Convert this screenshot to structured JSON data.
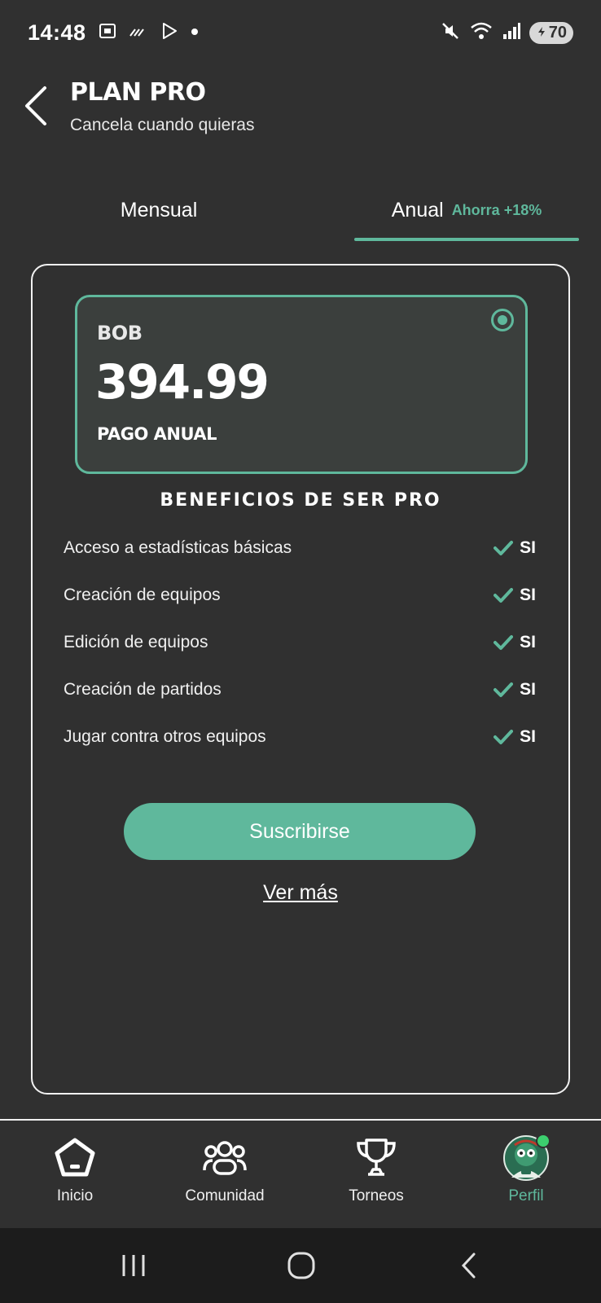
{
  "status_bar": {
    "time": "14:48",
    "battery": "70"
  },
  "header": {
    "title": "PLAN PRO",
    "subtitle": "Cancela cuando quieras"
  },
  "tabs": {
    "monthly": "Mensual",
    "annual": "Anual",
    "annual_badge": "Ahorra +18%",
    "selected": "annual"
  },
  "plan": {
    "currency": "BOB",
    "price": "394.99",
    "billing": "PAGO ANUAL"
  },
  "benefits": {
    "title": "BENEFICIOS DE SER PRO",
    "items": [
      {
        "label": "Acceso a estadísticas básicas",
        "value": "SI"
      },
      {
        "label": "Creación de equipos",
        "value": "SI"
      },
      {
        "label": "Edición de equipos",
        "value": "SI"
      },
      {
        "label": "Creación de partidos",
        "value": "SI"
      },
      {
        "label": "Jugar contra otros equipos",
        "value": "SI"
      }
    ]
  },
  "actions": {
    "subscribe": "Suscribirse",
    "see_more": "Ver más"
  },
  "bottom_nav": {
    "items": [
      {
        "label": "Inicio",
        "icon": "home-icon"
      },
      {
        "label": "Comunidad",
        "icon": "community-icon"
      },
      {
        "label": "Torneos",
        "icon": "trophy-icon"
      },
      {
        "label": "Perfil",
        "icon": "avatar"
      }
    ],
    "active": "Perfil"
  },
  "colors": {
    "background": "#303030",
    "accent": "#5fb89c",
    "card": "#3b3f3d"
  }
}
